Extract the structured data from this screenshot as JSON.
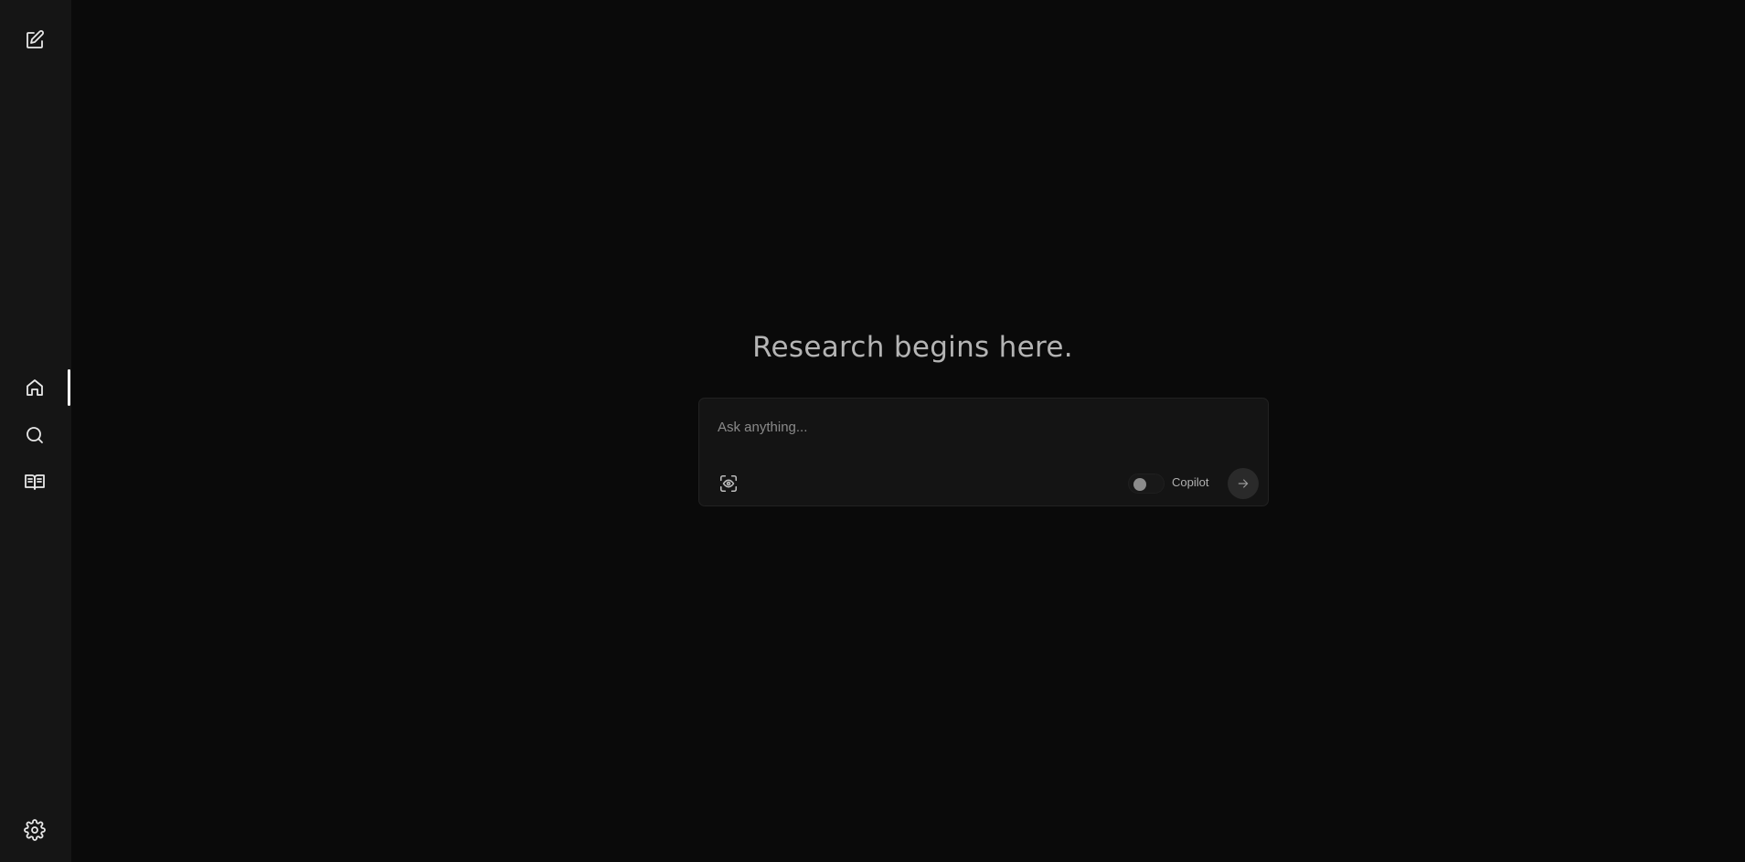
{
  "sidebar": {
    "new_thread_icon": "pencil-square-icon",
    "items": [
      {
        "name": "home",
        "icon": "home-icon",
        "active": true
      },
      {
        "name": "discover",
        "icon": "search-icon",
        "active": false
      },
      {
        "name": "library",
        "icon": "book-open-icon",
        "active": false
      }
    ],
    "settings_icon": "gear-icon"
  },
  "main": {
    "headline": "Research begins here.",
    "ask": {
      "placeholder": "Ask anything...",
      "value": "",
      "focus_icon": "eye-scan-icon",
      "copilot_label": "Copilot",
      "copilot_enabled": false,
      "submit_icon": "arrow-right-icon"
    }
  },
  "colors": {
    "background": "#0a0a0a",
    "sidebar": "#151515",
    "headline": "#b4b4b4",
    "box": "#141414",
    "active_indicator": "#ffffff"
  }
}
